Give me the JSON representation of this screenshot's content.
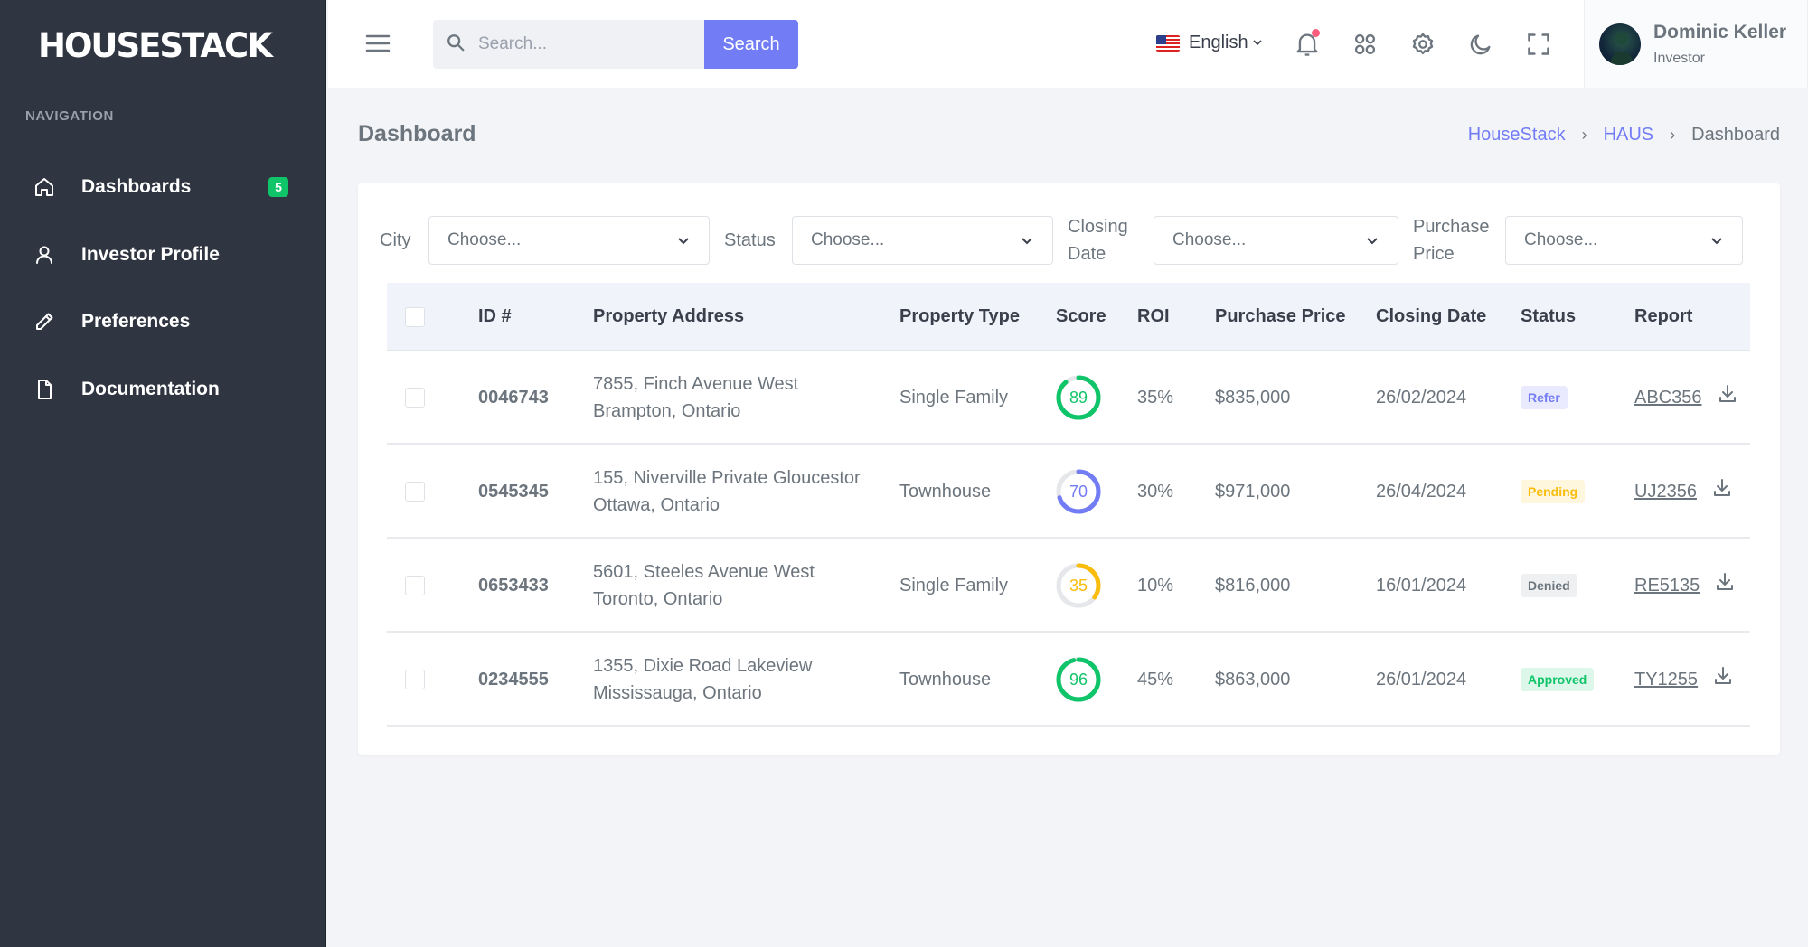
{
  "brand": {
    "logo_text": "HOUSESTACK"
  },
  "sidebar": {
    "nav_title": "NAVIGATION",
    "items": [
      {
        "label": "Dashboards",
        "icon": "home-icon",
        "badge": "5"
      },
      {
        "label": "Investor Profile",
        "icon": "user-icon"
      },
      {
        "label": "Preferences",
        "icon": "pencil-icon"
      },
      {
        "label": "Documentation",
        "icon": "file-icon"
      }
    ]
  },
  "topbar": {
    "search_placeholder": "Search...",
    "search_button": "Search",
    "language": "English",
    "user": {
      "name": "Dominic Keller",
      "role": "Investor"
    }
  },
  "page": {
    "title": "Dashboard",
    "breadcrumb": [
      "HouseStack",
      "HAUS",
      "Dashboard"
    ]
  },
  "filters": [
    {
      "label": "City",
      "value": "Choose..."
    },
    {
      "label": "Status",
      "value": "Choose..."
    },
    {
      "label_line1": "Closing",
      "label_line2": "Date",
      "value": "Choose..."
    },
    {
      "label_line1": "Purchase",
      "label_line2": "Price",
      "value": "Choose..."
    }
  ],
  "table": {
    "columns": [
      "ID #",
      "Property Address",
      "Property Type",
      "Score",
      "ROI",
      "Purchase Price",
      "Closing Date",
      "Status",
      "Report"
    ],
    "rows": [
      {
        "id": "0046743",
        "address_line1": "7855, Finch Avenue West",
        "address_line2": "Brampton, Ontario",
        "type": "Single Family",
        "score": 89,
        "score_color": "#10c469",
        "roi": "35%",
        "price": "$835,000",
        "closing": "26/02/2024",
        "status": "Refer",
        "status_fg": "#727cf5",
        "status_bg": "#e9eafd",
        "report": "ABC356"
      },
      {
        "id": "0545345",
        "address_line1": "155, Niverville Private Gloucestor",
        "address_line2": "Ottawa, Ontario",
        "type": "Townhouse",
        "score": 70,
        "score_color": "#727cf5",
        "roi": "30%",
        "price": "$971,000",
        "closing": "26/04/2024",
        "status": "Pending",
        "status_fg": "#f9bc0b",
        "status_bg": "#fef6dd",
        "report": "UJ2356"
      },
      {
        "id": "0653433",
        "address_line1": "5601, Steeles Avenue West",
        "address_line2": "Toronto, Ontario",
        "type": "Single Family",
        "score": 35,
        "score_color": "#f9bc0b",
        "roi": "10%",
        "price": "$816,000",
        "closing": "16/01/2024",
        "status": "Denied",
        "status_fg": "#6c757d",
        "status_bg": "#eef0f2",
        "report": "RE5135"
      },
      {
        "id": "0234555",
        "address_line1": "1355, Dixie Road Lakeview",
        "address_line2": "Mississauga, Ontario",
        "type": "Townhouse",
        "score": 96,
        "score_color": "#10c469",
        "roi": "45%",
        "price": "$863,000",
        "closing": "26/01/2024",
        "status": "Approved",
        "status_fg": "#10c469",
        "status_bg": "#ddf7ea",
        "report": "TY1255"
      }
    ]
  },
  "colors": {
    "sidebar_bg": "#2f3541",
    "accent": "#727cf5",
    "success": "#10c469"
  }
}
